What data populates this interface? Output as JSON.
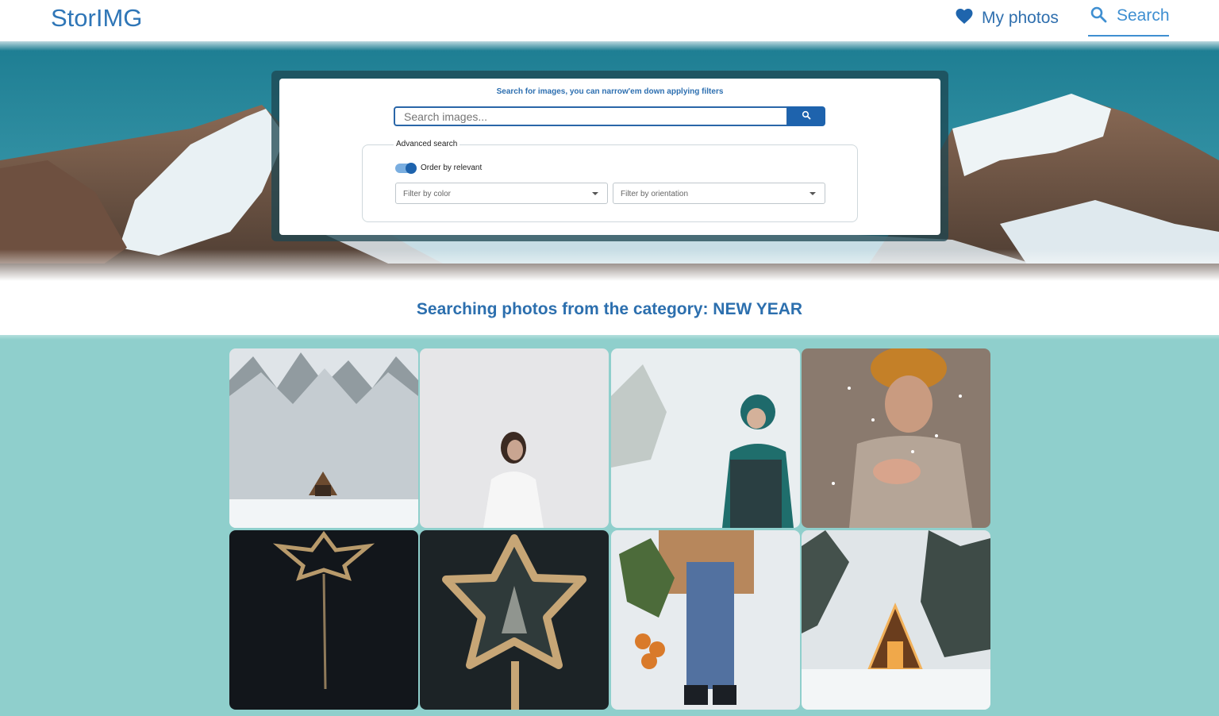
{
  "header": {
    "brand": "StorIMG",
    "nav": [
      {
        "label": "My photos",
        "icon": "heart-icon"
      },
      {
        "label": "Search",
        "icon": "search-icon",
        "active": true
      }
    ]
  },
  "search": {
    "hint": "Search for images, you can narrow'em down applying filters",
    "placeholder": "Search images...",
    "button_icon": "search-icon",
    "advanced": {
      "legend": "Advanced search",
      "toggle_label": "Order by relevant",
      "toggle_on": true,
      "color_filter_placeholder": "Filter by color",
      "orientation_filter_placeholder": "Filter by orientation"
    }
  },
  "category": {
    "title": "Searching photos from the category: NEW YEAR"
  },
  "colors": {
    "brand": "#2f76b7",
    "accent": "#1e63ad",
    "page_background": "#8fcfcc"
  },
  "photos": [
    {
      "subject": "snowy forest cabin"
    },
    {
      "subject": "woman in white sweater in snow"
    },
    {
      "subject": "woman in green hooded jacket throwing snow"
    },
    {
      "subject": "person blowing snow from hands"
    },
    {
      "subject": "star-shaped sparkler dark background"
    },
    {
      "subject": "frozen star candy with frost pattern"
    },
    {
      "subject": "person with pine branches and orange net bag"
    },
    {
      "subject": "a-frame cabin with lights in snowy forest"
    }
  ]
}
